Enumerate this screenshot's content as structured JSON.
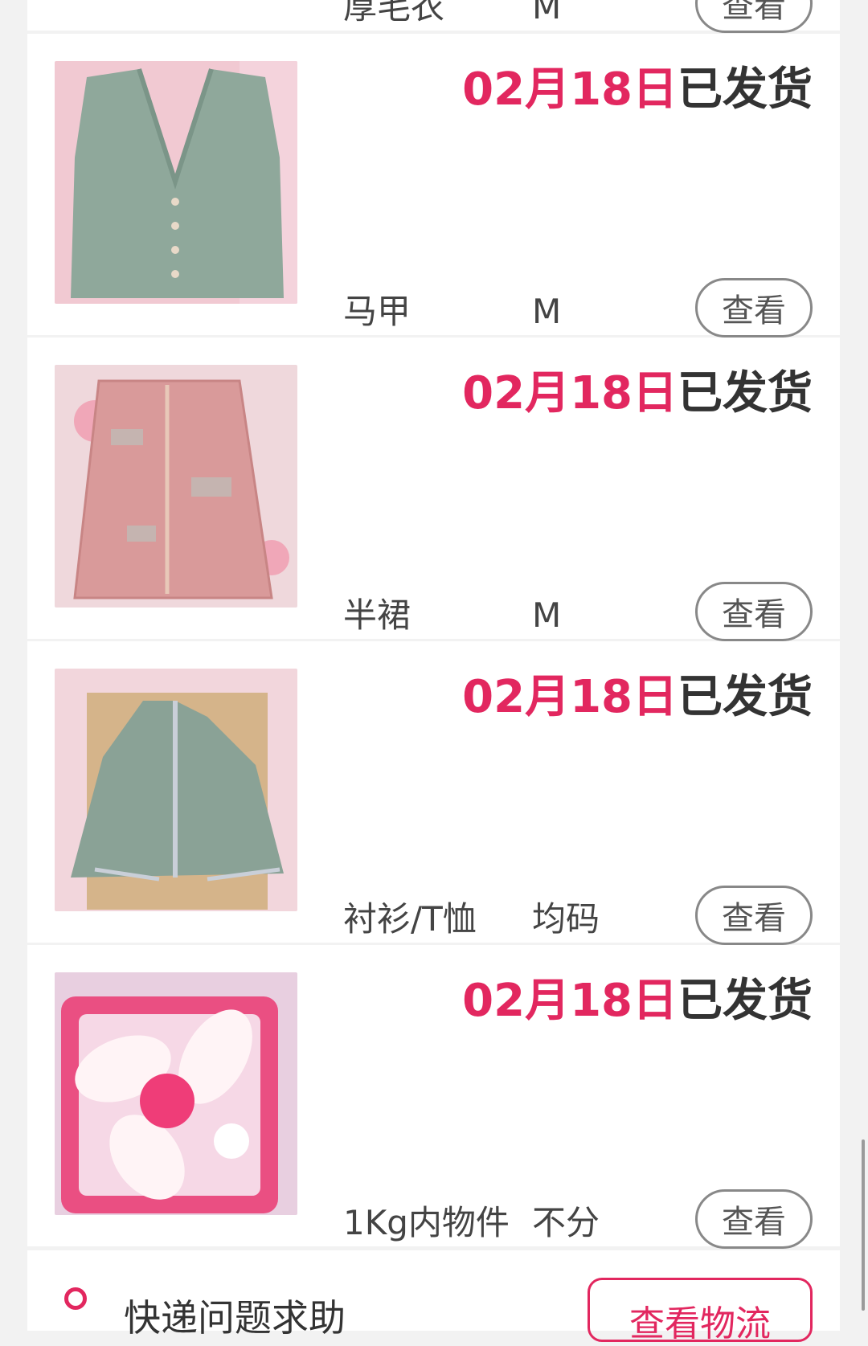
{
  "accent_color": "#e2275f",
  "view_label": "查看",
  "items": [
    {
      "date": "",
      "status": "",
      "name": "厚毛衣",
      "size": "M",
      "image_icon": "product-photo"
    },
    {
      "date": "02月18日",
      "status": "已发货",
      "name": "马甲",
      "size": "M",
      "image_icon": "product-photo"
    },
    {
      "date": "02月18日",
      "status": "已发货",
      "name": "半裙",
      "size": "M",
      "image_icon": "product-photo"
    },
    {
      "date": "02月18日",
      "status": "已发货",
      "name": "衬衫/T恤",
      "size": "均码",
      "image_icon": "product-photo"
    },
    {
      "date": "02月18日",
      "status": "已发货",
      "name": "1Kg内物件",
      "size": "不分",
      "image_icon": "product-photo"
    }
  ],
  "help": {
    "text": "快递问题求助",
    "button": "查看物流"
  }
}
